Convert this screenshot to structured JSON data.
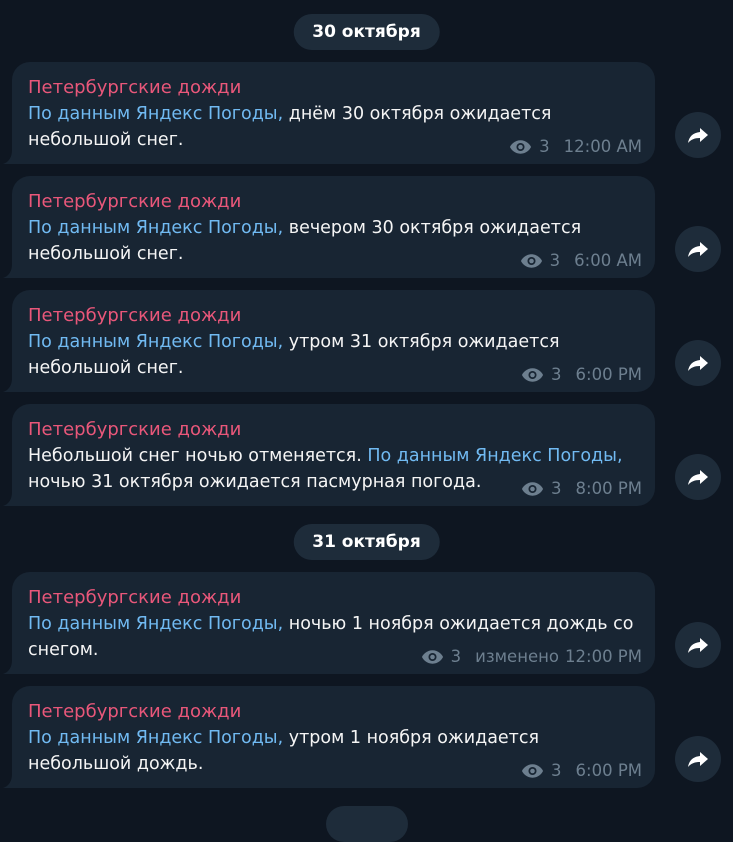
{
  "dates": [
    "30 октября",
    "31 октября"
  ],
  "messages": [
    {
      "sender": "Петербургские дожди",
      "parts": [
        {
          "text": "По данным Яндекс Погоды,",
          "link": true
        },
        {
          "text": " днём 30 октября ожидается небольшой снег.",
          "link": false
        }
      ],
      "views": "3",
      "edited": "",
      "time": "12:00 AM"
    },
    {
      "sender": "Петербургские дожди",
      "parts": [
        {
          "text": "По данным Яндекс Погоды,",
          "link": true
        },
        {
          "text": " вечером 30 октября ожидается небольшой снег.",
          "link": false
        }
      ],
      "views": "3",
      "edited": "",
      "time": "6:00 AM"
    },
    {
      "sender": "Петербургские дожди",
      "parts": [
        {
          "text": "По данным Яндекс Погоды,",
          "link": true
        },
        {
          "text": " утром 31 октября ожидается небольшой снег.",
          "link": false
        }
      ],
      "views": "3",
      "edited": "",
      "time": "6:00 PM"
    },
    {
      "sender": "Петербургские дожди",
      "parts": [
        {
          "text": "Небольшой снег ночью отменяется. ",
          "link": false
        },
        {
          "text": "По данным Яндекс Погоды,",
          "link": true
        },
        {
          "text": " ночью 31 октября ожидается пасмурная погода.",
          "link": false
        }
      ],
      "views": "3",
      "edited": "",
      "time": "8:00 PM"
    },
    {
      "sender": "Петербургские дожди",
      "parts": [
        {
          "text": "По данным Яндекс Погоды,",
          "link": true
        },
        {
          "text": " ночью 1 ноября ожидается дождь со снегом.",
          "link": false
        }
      ],
      "views": "3",
      "edited": "изменено",
      "time": "12:00 PM"
    },
    {
      "sender": "Петербургские дожди",
      "parts": [
        {
          "text": "По данным Яндекс Погоды,",
          "link": true
        },
        {
          "text": " утром 1 ноября ожидается небольшой дождь.",
          "link": false
        }
      ],
      "views": "3",
      "edited": "",
      "time": "6:00 PM"
    }
  ],
  "icons": {
    "views": "eye-icon",
    "share": "share-arrow-icon"
  },
  "colors": {
    "background": "#0e1621",
    "bubble": "#182533",
    "sender": "#e9577a",
    "link": "#71baf2",
    "meta": "#6d7f8f"
  }
}
